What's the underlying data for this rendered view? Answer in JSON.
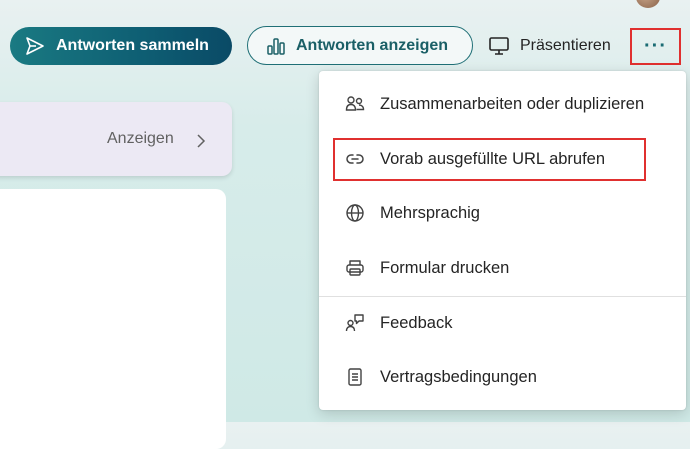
{
  "toolbar": {
    "collect_label": "Antworten sammeln",
    "show_label": "Antworten anzeigen",
    "present_label": "Präsentieren",
    "more_label": "···"
  },
  "card": {
    "anzeigen_label": "Anzeigen"
  },
  "menu": {
    "items": [
      {
        "label": "Zusammenarbeiten oder duplizieren",
        "icon": "people-icon"
      },
      {
        "label": "Vorab ausgefüllte URL abrufen",
        "icon": "link-icon"
      },
      {
        "label": "Mehrsprachig",
        "icon": "globe-icon"
      },
      {
        "label": "Formular drucken",
        "icon": "printer-icon"
      },
      {
        "label": "Feedback",
        "icon": "feedback-icon"
      },
      {
        "label": "Vertragsbedingungen",
        "icon": "document-icon"
      }
    ]
  },
  "colors": {
    "accent": "#1a6b73",
    "highlight": "#e0302f",
    "card_lavender": "#ece9f4"
  }
}
